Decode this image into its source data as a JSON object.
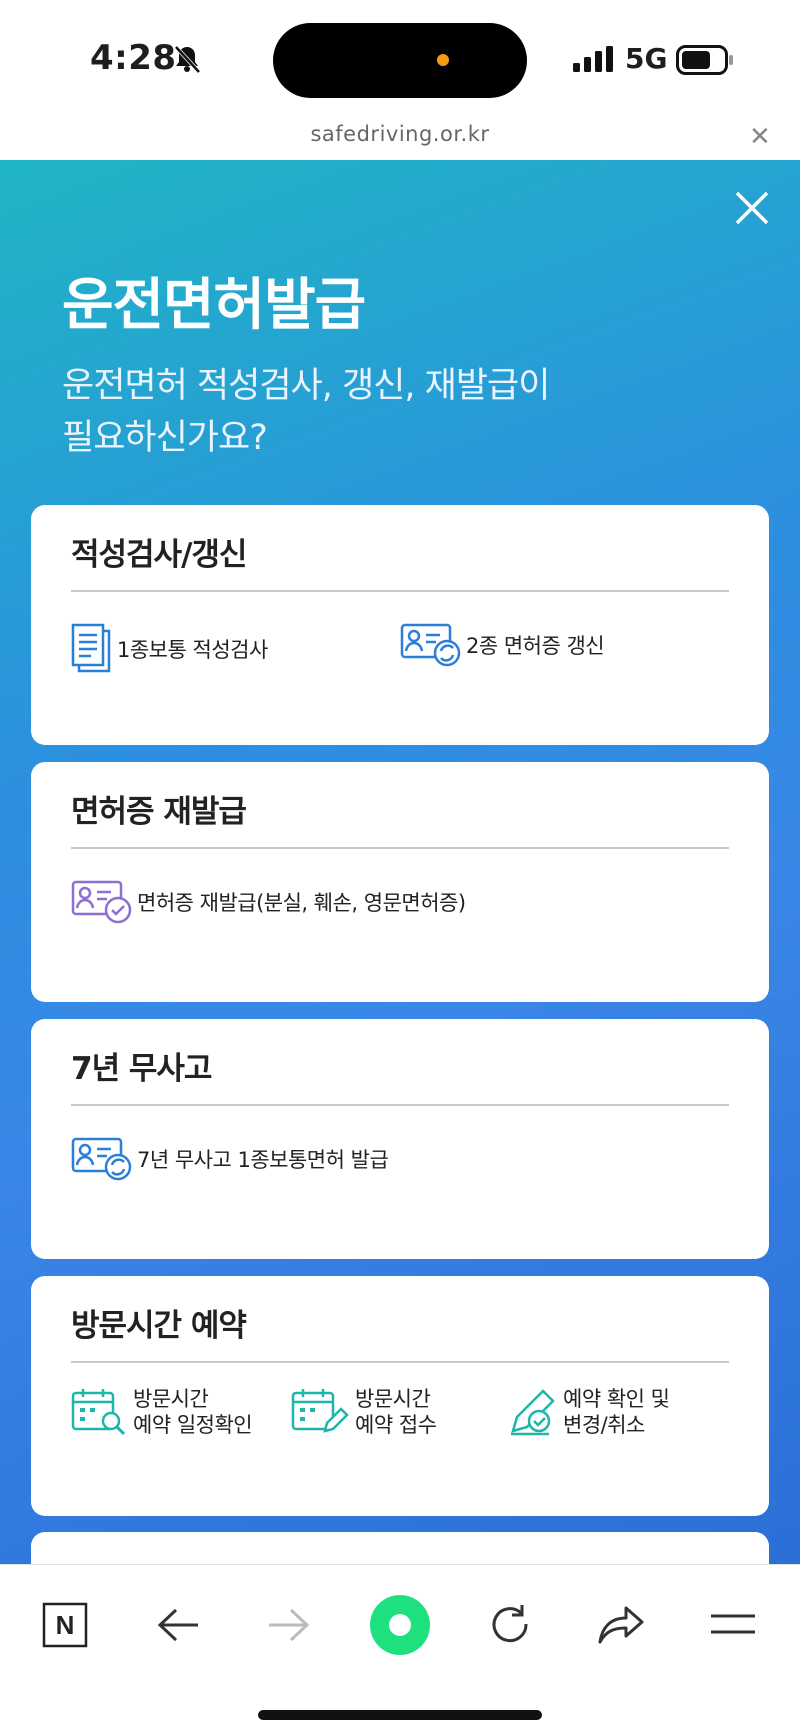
{
  "status": {
    "time": "4:28",
    "network": "5G"
  },
  "browser": {
    "url": "safedriving.or.kr",
    "close_symbol": "✕"
  },
  "hero": {
    "title": "운전면허발급",
    "subtitle_line1": "운전면허 적성검사, 갱신, 재발급이",
    "subtitle_line2": "필요하신가요?"
  },
  "cards": [
    {
      "title": "적성검사/갱신",
      "items": [
        {
          "label": "1종보통 적성검사",
          "icon": "document-icon"
        },
        {
          "label": "2종 면허증 갱신",
          "icon": "license-renew-icon"
        }
      ]
    },
    {
      "title": "면허증 재발급",
      "items": [
        {
          "label": "면허증 재발급(분실, 훼손, 영문면허증)",
          "icon": "license-check-icon"
        }
      ]
    },
    {
      "title": "7년 무사고",
      "items": [
        {
          "label": "7년 무사고 1종보통면허 발급",
          "icon": "license-renew-icon"
        }
      ]
    },
    {
      "title": "방문시간 예약",
      "items": [
        {
          "line1": "방문시간",
          "line2": "예약 일정확인",
          "icon": "calendar-search-icon"
        },
        {
          "line1": "방문시간",
          "line2": "예약 접수",
          "icon": "calendar-write-icon"
        },
        {
          "line1": "예약 확인 및",
          "line2": "변경/취소",
          "icon": "pencil-check-icon"
        }
      ]
    }
  ],
  "colors": {
    "accent_teal": "#1fb5a8",
    "accent_blue": "#2a7fd8",
    "accent_purple": "#8b6fd1",
    "nav_green": "#1ee07f"
  },
  "bottom_nav": {
    "n_label": "N"
  }
}
